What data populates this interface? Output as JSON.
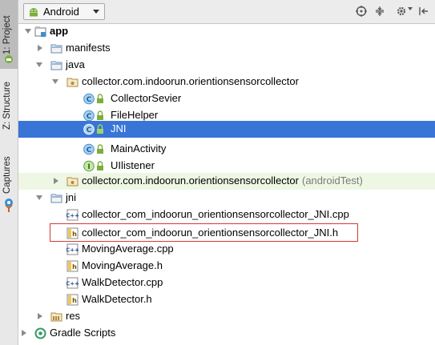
{
  "sidebar": {
    "tabs": [
      {
        "label": "1: Project",
        "active": true
      },
      {
        "label": "Z: Structure",
        "active": false
      },
      {
        "label": "Captures",
        "active": false
      }
    ]
  },
  "toolbar": {
    "view_mode": "Android",
    "icons": [
      "target-icon",
      "collapse-icon",
      "gear-icon",
      "hide-icon"
    ]
  },
  "tree": [
    {
      "label": "app",
      "bold": true,
      "icon": "module-icon",
      "arrow": "down"
    },
    {
      "label": "manifests",
      "icon": "folder-icon",
      "arrow": "right"
    },
    {
      "label": "java",
      "icon": "folder-icon",
      "arrow": "down"
    },
    {
      "label": "collector.com.indoorun.orientionsensorcollector",
      "icon": "package-icon",
      "arrow": "down"
    },
    {
      "label": "CollectorSevier",
      "icon": "class-icon"
    },
    {
      "label": "FileHelper",
      "icon": "class-icon"
    },
    {
      "label": "JNI",
      "icon": "class-icon",
      "selected": true
    },
    {
      "label": "MainActivity",
      "icon": "class-icon"
    },
    {
      "label": "UIlistener",
      "icon": "interface-icon"
    },
    {
      "label": "collector.com.indoorun.orientionsensorcollector",
      "suffix": "(androidTest)",
      "icon": "package-icon",
      "arrow": "right",
      "highlight": true
    },
    {
      "label": "jni",
      "icon": "folder-icon",
      "arrow": "down"
    },
    {
      "label": "collector_com_indoorun_orientionsensorcollector_JNI.cpp",
      "icon": "cpp-file-icon"
    },
    {
      "label": "collector_com_indoorun_orientionsensorcollector_JNI.h",
      "icon": "h-file-icon"
    },
    {
      "label": "MovingAverage.cpp",
      "icon": "cpp-file-icon"
    },
    {
      "label": "MovingAverage.h",
      "icon": "h-file-icon"
    },
    {
      "label": "WalkDetector.cpp",
      "icon": "cpp-file-icon"
    },
    {
      "label": "WalkDetector.h",
      "icon": "h-file-icon"
    },
    {
      "label": "res",
      "icon": "res-folder-icon",
      "arrow": "right"
    },
    {
      "label": "Gradle Scripts",
      "icon": "gradle-icon",
      "arrow": "right"
    }
  ],
  "colors": {
    "selection": "#3875d7",
    "highlight_row": "#eef7e4",
    "annotation_box": "#d43a3a",
    "class_icon": "#3d8fd1",
    "interface_icon": "#58a23a"
  }
}
